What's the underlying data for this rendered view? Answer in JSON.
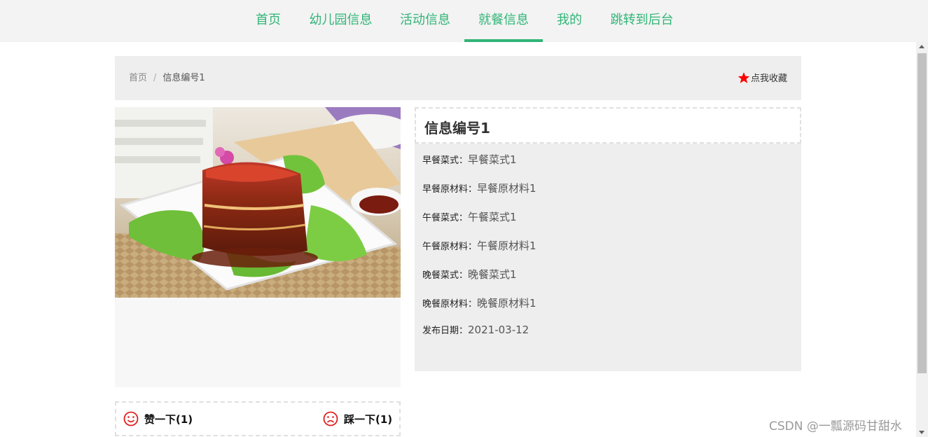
{
  "nav": {
    "items": [
      {
        "label": "首页"
      },
      {
        "label": "幼儿园信息"
      },
      {
        "label": "活动信息"
      },
      {
        "label": "就餐信息"
      },
      {
        "label": "我的"
      },
      {
        "label": "跳转到后台"
      }
    ],
    "active": "就餐信息"
  },
  "breadcrumb": {
    "home": "首页",
    "separator": "/",
    "current": "信息编号1"
  },
  "favorite": {
    "label": "点我收藏",
    "icon": "star-icon",
    "color": "#ff0000"
  },
  "detail": {
    "title": "信息编号1",
    "fields": [
      {
        "label": "早餐菜式：",
        "value": "早餐菜式1"
      },
      {
        "label": "早餐原材料：",
        "value": "早餐原材料1"
      },
      {
        "label": "午餐菜式：",
        "value": "午餐菜式1"
      },
      {
        "label": "午餐原材料：",
        "value": "午餐原材料1"
      },
      {
        "label": "晚餐菜式：",
        "value": "晚餐菜式1"
      },
      {
        "label": "晚餐原材料：",
        "value": "晚餐原材料1"
      },
      {
        "label": "发布日期：",
        "value": "2021-03-12"
      }
    ]
  },
  "votes": {
    "like": {
      "label": "赞一下(1)",
      "icon": "smile-icon"
    },
    "dislike": {
      "label": "踩一下(1)",
      "icon": "frown-icon"
    }
  },
  "photo": {
    "subject": "braised pork belly dish"
  },
  "colors": {
    "accent": "#31b577",
    "vote_icon": "#e02020"
  },
  "watermark": "CSDN @一瓢源码甘甜水"
}
